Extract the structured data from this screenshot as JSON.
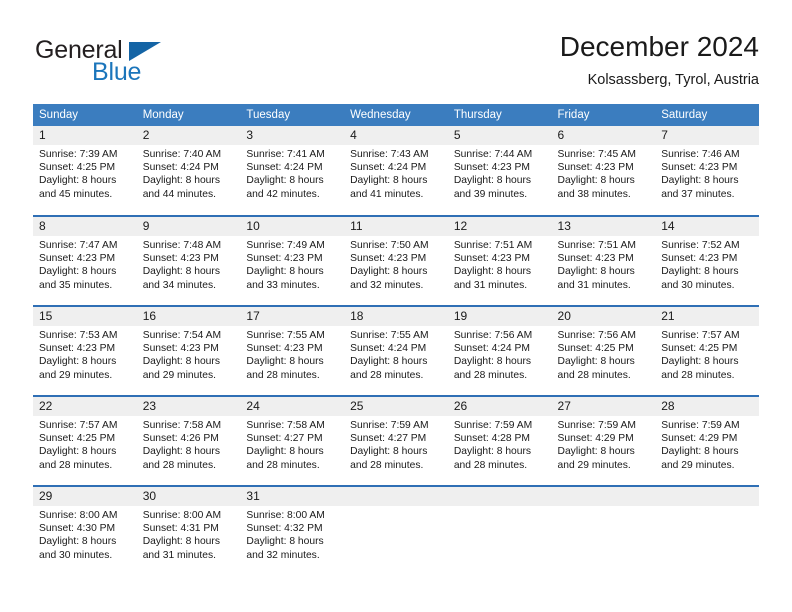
{
  "brand": {
    "name_part1": "General",
    "name_part2": "Blue",
    "triangle_color": "#1464a5",
    "blue_color": "#1b75bb"
  },
  "header": {
    "month_title": "December 2024",
    "location": "Kolsassberg, Tyrol, Austria"
  },
  "theme": {
    "header_bg": "#3b7dbf",
    "row_divider": "#2f6fb5",
    "daynum_bg": "#efefef"
  },
  "weekday_headers": [
    "Sunday",
    "Monday",
    "Tuesday",
    "Wednesday",
    "Thursday",
    "Friday",
    "Saturday"
  ],
  "weeks": [
    [
      {
        "day": "1",
        "sunrise": "Sunrise: 7:39 AM",
        "sunset": "Sunset: 4:25 PM",
        "daylight_1": "Daylight: 8 hours",
        "daylight_2": "and 45 minutes."
      },
      {
        "day": "2",
        "sunrise": "Sunrise: 7:40 AM",
        "sunset": "Sunset: 4:24 PM",
        "daylight_1": "Daylight: 8 hours",
        "daylight_2": "and 44 minutes."
      },
      {
        "day": "3",
        "sunrise": "Sunrise: 7:41 AM",
        "sunset": "Sunset: 4:24 PM",
        "daylight_1": "Daylight: 8 hours",
        "daylight_2": "and 42 minutes."
      },
      {
        "day": "4",
        "sunrise": "Sunrise: 7:43 AM",
        "sunset": "Sunset: 4:24 PM",
        "daylight_1": "Daylight: 8 hours",
        "daylight_2": "and 41 minutes."
      },
      {
        "day": "5",
        "sunrise": "Sunrise: 7:44 AM",
        "sunset": "Sunset: 4:23 PM",
        "daylight_1": "Daylight: 8 hours",
        "daylight_2": "and 39 minutes."
      },
      {
        "day": "6",
        "sunrise": "Sunrise: 7:45 AM",
        "sunset": "Sunset: 4:23 PM",
        "daylight_1": "Daylight: 8 hours",
        "daylight_2": "and 38 minutes."
      },
      {
        "day": "7",
        "sunrise": "Sunrise: 7:46 AM",
        "sunset": "Sunset: 4:23 PM",
        "daylight_1": "Daylight: 8 hours",
        "daylight_2": "and 37 minutes."
      }
    ],
    [
      {
        "day": "8",
        "sunrise": "Sunrise: 7:47 AM",
        "sunset": "Sunset: 4:23 PM",
        "daylight_1": "Daylight: 8 hours",
        "daylight_2": "and 35 minutes."
      },
      {
        "day": "9",
        "sunrise": "Sunrise: 7:48 AM",
        "sunset": "Sunset: 4:23 PM",
        "daylight_1": "Daylight: 8 hours",
        "daylight_2": "and 34 minutes."
      },
      {
        "day": "10",
        "sunrise": "Sunrise: 7:49 AM",
        "sunset": "Sunset: 4:23 PM",
        "daylight_1": "Daylight: 8 hours",
        "daylight_2": "and 33 minutes."
      },
      {
        "day": "11",
        "sunrise": "Sunrise: 7:50 AM",
        "sunset": "Sunset: 4:23 PM",
        "daylight_1": "Daylight: 8 hours",
        "daylight_2": "and 32 minutes."
      },
      {
        "day": "12",
        "sunrise": "Sunrise: 7:51 AM",
        "sunset": "Sunset: 4:23 PM",
        "daylight_1": "Daylight: 8 hours",
        "daylight_2": "and 31 minutes."
      },
      {
        "day": "13",
        "sunrise": "Sunrise: 7:51 AM",
        "sunset": "Sunset: 4:23 PM",
        "daylight_1": "Daylight: 8 hours",
        "daylight_2": "and 31 minutes."
      },
      {
        "day": "14",
        "sunrise": "Sunrise: 7:52 AM",
        "sunset": "Sunset: 4:23 PM",
        "daylight_1": "Daylight: 8 hours",
        "daylight_2": "and 30 minutes."
      }
    ],
    [
      {
        "day": "15",
        "sunrise": "Sunrise: 7:53 AM",
        "sunset": "Sunset: 4:23 PM",
        "daylight_1": "Daylight: 8 hours",
        "daylight_2": "and 29 minutes."
      },
      {
        "day": "16",
        "sunrise": "Sunrise: 7:54 AM",
        "sunset": "Sunset: 4:23 PM",
        "daylight_1": "Daylight: 8 hours",
        "daylight_2": "and 29 minutes."
      },
      {
        "day": "17",
        "sunrise": "Sunrise: 7:55 AM",
        "sunset": "Sunset: 4:23 PM",
        "daylight_1": "Daylight: 8 hours",
        "daylight_2": "and 28 minutes."
      },
      {
        "day": "18",
        "sunrise": "Sunrise: 7:55 AM",
        "sunset": "Sunset: 4:24 PM",
        "daylight_1": "Daylight: 8 hours",
        "daylight_2": "and 28 minutes."
      },
      {
        "day": "19",
        "sunrise": "Sunrise: 7:56 AM",
        "sunset": "Sunset: 4:24 PM",
        "daylight_1": "Daylight: 8 hours",
        "daylight_2": "and 28 minutes."
      },
      {
        "day": "20",
        "sunrise": "Sunrise: 7:56 AM",
        "sunset": "Sunset: 4:25 PM",
        "daylight_1": "Daylight: 8 hours",
        "daylight_2": "and 28 minutes."
      },
      {
        "day": "21",
        "sunrise": "Sunrise: 7:57 AM",
        "sunset": "Sunset: 4:25 PM",
        "daylight_1": "Daylight: 8 hours",
        "daylight_2": "and 28 minutes."
      }
    ],
    [
      {
        "day": "22",
        "sunrise": "Sunrise: 7:57 AM",
        "sunset": "Sunset: 4:25 PM",
        "daylight_1": "Daylight: 8 hours",
        "daylight_2": "and 28 minutes."
      },
      {
        "day": "23",
        "sunrise": "Sunrise: 7:58 AM",
        "sunset": "Sunset: 4:26 PM",
        "daylight_1": "Daylight: 8 hours",
        "daylight_2": "and 28 minutes."
      },
      {
        "day": "24",
        "sunrise": "Sunrise: 7:58 AM",
        "sunset": "Sunset: 4:27 PM",
        "daylight_1": "Daylight: 8 hours",
        "daylight_2": "and 28 minutes."
      },
      {
        "day": "25",
        "sunrise": "Sunrise: 7:59 AM",
        "sunset": "Sunset: 4:27 PM",
        "daylight_1": "Daylight: 8 hours",
        "daylight_2": "and 28 minutes."
      },
      {
        "day": "26",
        "sunrise": "Sunrise: 7:59 AM",
        "sunset": "Sunset: 4:28 PM",
        "daylight_1": "Daylight: 8 hours",
        "daylight_2": "and 28 minutes."
      },
      {
        "day": "27",
        "sunrise": "Sunrise: 7:59 AM",
        "sunset": "Sunset: 4:29 PM",
        "daylight_1": "Daylight: 8 hours",
        "daylight_2": "and 29 minutes."
      },
      {
        "day": "28",
        "sunrise": "Sunrise: 7:59 AM",
        "sunset": "Sunset: 4:29 PM",
        "daylight_1": "Daylight: 8 hours",
        "daylight_2": "and 29 minutes."
      }
    ],
    [
      {
        "day": "29",
        "sunrise": "Sunrise: 8:00 AM",
        "sunset": "Sunset: 4:30 PM",
        "daylight_1": "Daylight: 8 hours",
        "daylight_2": "and 30 minutes."
      },
      {
        "day": "30",
        "sunrise": "Sunrise: 8:00 AM",
        "sunset": "Sunset: 4:31 PM",
        "daylight_1": "Daylight: 8 hours",
        "daylight_2": "and 31 minutes."
      },
      {
        "day": "31",
        "sunrise": "Sunrise: 8:00 AM",
        "sunset": "Sunset: 4:32 PM",
        "daylight_1": "Daylight: 8 hours",
        "daylight_2": "and 32 minutes."
      },
      {
        "day": "",
        "sunrise": "",
        "sunset": "",
        "daylight_1": "",
        "daylight_2": ""
      },
      {
        "day": "",
        "sunrise": "",
        "sunset": "",
        "daylight_1": "",
        "daylight_2": ""
      },
      {
        "day": "",
        "sunrise": "",
        "sunset": "",
        "daylight_1": "",
        "daylight_2": ""
      },
      {
        "day": "",
        "sunrise": "",
        "sunset": "",
        "daylight_1": "",
        "daylight_2": ""
      }
    ]
  ]
}
